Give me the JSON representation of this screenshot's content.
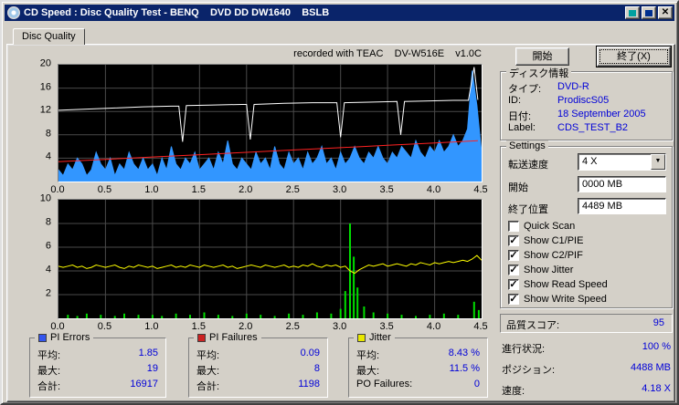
{
  "window": {
    "title": "CD Speed : Disc Quality Test - BENQ    DVD DD DW1640    BSLB",
    "close_glyph": "✕"
  },
  "icons": {
    "dropdown": "▼",
    "check": "✓"
  },
  "tab": {
    "label": "Disc Quality"
  },
  "recorded_with": "recorded with TEAC    DV-W516E    v1.0C",
  "actions": {
    "start_label": "開始",
    "exit_label": "終了(X)"
  },
  "chart_data": [
    {
      "type": "area",
      "title": "PI Errors with read/write speed overlay",
      "xlim": [
        0,
        4.5
      ],
      "ylim": [
        0,
        20
      ],
      "xgrid": 0.5,
      "ygrid": 4,
      "grid_color": "#4a4a4a",
      "xticks": [
        "0.0",
        "0.5",
        "1.0",
        "1.5",
        "2.0",
        "2.5",
        "3.0",
        "3.5",
        "4.0",
        "4.5"
      ],
      "yticks": [
        "20",
        "16",
        "12",
        "8",
        "4"
      ],
      "series": [
        {
          "name": "PI Errors",
          "render": "area",
          "color": "#3296ff",
          "x_step": 0.05,
          "values": [
            2,
            1,
            3,
            2,
            4,
            3,
            1,
            2,
            5,
            3,
            2,
            4,
            1,
            3,
            2,
            5,
            3,
            2,
            4,
            2,
            3,
            1,
            4,
            2,
            6,
            3,
            2,
            4,
            3,
            5,
            2,
            3,
            4,
            2,
            5,
            3,
            7,
            3,
            2,
            4,
            3,
            2,
            5,
            3,
            4,
            2,
            6,
            3,
            2,
            5,
            3,
            4,
            2,
            5,
            3,
            4,
            6,
            3,
            4,
            2,
            5,
            3,
            4,
            6,
            4,
            3,
            5,
            4,
            6,
            4,
            3,
            5,
            4,
            6,
            5,
            4,
            7,
            5,
            4,
            6,
            5,
            7,
            5,
            6,
            8,
            6,
            7,
            9,
            19,
            13,
            5
          ]
        },
        {
          "name": "Read Speed",
          "render": "line",
          "color": "#ff2222",
          "points": [
            [
              0,
              3.4
            ],
            [
              0.5,
              3.8
            ],
            [
              1.0,
              4.2
            ],
            [
              1.5,
              4.6
            ],
            [
              2.0,
              5.0
            ],
            [
              2.5,
              5.4
            ],
            [
              3.0,
              5.8
            ],
            [
              3.5,
              6.2
            ],
            [
              4.0,
              6.6
            ],
            [
              4.46,
              7.0
            ]
          ]
        },
        {
          "name": "Write Speed",
          "render": "line",
          "color": "#ffffff",
          "points": [
            [
              0,
              12.2
            ],
            [
              0.3,
              12.4
            ],
            [
              0.6,
              12.6
            ],
            [
              0.9,
              12.8
            ],
            [
              1.2,
              12.9
            ],
            [
              1.28,
              12.9
            ],
            [
              1.32,
              6.8
            ],
            [
              1.36,
              13.0
            ],
            [
              1.6,
              13.1
            ],
            [
              1.95,
              13.2
            ],
            [
              2.0,
              13.2
            ],
            [
              2.04,
              7.2
            ],
            [
              2.08,
              13.2
            ],
            [
              2.4,
              13.4
            ],
            [
              2.7,
              13.5
            ],
            [
              2.96,
              13.5
            ],
            [
              3.0,
              7.6
            ],
            [
              3.04,
              13.5
            ],
            [
              3.3,
              13.6
            ],
            [
              3.6,
              13.7
            ],
            [
              3.64,
              8.0
            ],
            [
              3.68,
              13.7
            ],
            [
              3.9,
              13.8
            ],
            [
              4.2,
              13.9
            ],
            [
              4.36,
              13.9
            ],
            [
              4.42,
              19.6
            ],
            [
              4.46,
              14.0
            ]
          ]
        }
      ]
    },
    {
      "type": "line",
      "title": "Jitter with PI Failures spikes",
      "xlim": [
        0,
        4.5
      ],
      "ylim": [
        0,
        10
      ],
      "xgrid": 0.5,
      "ygrid": 2,
      "grid_color": "#4a4a4a",
      "xticks": [
        "0.0",
        "0.5",
        "1.0",
        "1.5",
        "2.0",
        "2.5",
        "3.0",
        "3.5",
        "4.0",
        "4.5"
      ],
      "yticks": [
        "10",
        "8",
        "6",
        "4",
        "2"
      ],
      "series": [
        {
          "name": "PI Failures",
          "render": "bars",
          "color": "#00dd00",
          "points": [
            [
              0.1,
              0.3
            ],
            [
              0.2,
              0.2
            ],
            [
              0.3,
              0.4
            ],
            [
              0.45,
              0.3
            ],
            [
              0.6,
              0.2
            ],
            [
              0.7,
              0.4
            ],
            [
              0.85,
              0.3
            ],
            [
              1.0,
              0.3
            ],
            [
              1.1,
              0.2
            ],
            [
              1.25,
              0.4
            ],
            [
              1.4,
              0.3
            ],
            [
              1.55,
              0.5
            ],
            [
              1.7,
              0.3
            ],
            [
              1.85,
              0.2
            ],
            [
              2.0,
              0.4
            ],
            [
              2.15,
              0.3
            ],
            [
              2.3,
              0.2
            ],
            [
              2.45,
              0.4
            ],
            [
              2.6,
              0.3
            ],
            [
              2.75,
              0.5
            ],
            [
              2.9,
              0.4
            ],
            [
              3.0,
              0.8
            ],
            [
              3.05,
              2.3
            ],
            [
              3.1,
              8.0
            ],
            [
              3.14,
              5.2
            ],
            [
              3.18,
              2.6
            ],
            [
              3.25,
              1.0
            ],
            [
              3.35,
              0.5
            ],
            [
              3.5,
              0.4
            ],
            [
              3.65,
              0.3
            ],
            [
              3.8,
              0.2
            ],
            [
              3.95,
              0.3
            ],
            [
              4.1,
              0.4
            ],
            [
              4.25,
              0.3
            ],
            [
              4.42,
              1.4
            ],
            [
              4.47,
              0.7
            ]
          ]
        },
        {
          "name": "Jitter",
          "render": "line",
          "color": "#ffff00",
          "x_step": 0.05,
          "values": [
            4.4,
            4.3,
            4.4,
            4.5,
            4.3,
            4.4,
            4.2,
            4.3,
            4.5,
            4.4,
            4.3,
            4.4,
            4.5,
            4.3,
            4.2,
            4.4,
            4.3,
            4.5,
            4.4,
            4.3,
            4.4,
            4.2,
            4.3,
            4.4,
            4.5,
            4.3,
            4.4,
            4.3,
            4.5,
            4.4,
            4.3,
            4.5,
            4.4,
            4.3,
            4.4,
            4.5,
            4.3,
            4.4,
            4.2,
            4.3,
            4.4,
            4.5,
            4.4,
            4.3,
            4.5,
            4.4,
            4.3,
            4.4,
            4.5,
            4.3,
            4.4,
            4.3,
            4.5,
            4.4,
            4.6,
            4.4,
            4.3,
            4.5,
            4.4,
            4.5,
            4.3,
            4.4,
            4.0,
            3.8,
            4.1,
            4.3,
            4.5,
            4.4,
            4.5,
            4.6,
            4.4,
            4.5,
            4.6,
            4.5,
            4.4,
            4.6,
            4.5,
            4.7,
            4.6,
            4.5,
            4.7,
            4.6,
            4.7,
            4.8,
            4.7,
            4.8,
            4.9,
            4.8,
            5.0,
            5.3,
            4.9
          ]
        }
      ]
    }
  ],
  "stat_boxes": [
    {
      "legend": "PI Errors",
      "color": "#3355ee",
      "rows": [
        {
          "label": "平均:",
          "value": "1.85"
        },
        {
          "label": "最大:",
          "value": "19"
        },
        {
          "label": "合計:",
          "value": "16917"
        }
      ]
    },
    {
      "legend": "PI Failures",
      "color": "#cc2222",
      "rows": [
        {
          "label": "平均:",
          "value": "0.09"
        },
        {
          "label": "最大:",
          "value": "8"
        },
        {
          "label": "合計:",
          "value": "1198"
        }
      ]
    },
    {
      "legend": "Jitter",
      "color": "#e8e800",
      "rows": [
        {
          "label": "平均:",
          "value": "8.43 %"
        },
        {
          "label": "最大:",
          "value": "11.5 %"
        },
        {
          "label": "PO Failures:",
          "value": "0"
        }
      ]
    }
  ],
  "disc_info": {
    "title": "ディスク情報",
    "rows": [
      {
        "label": "タイプ:",
        "value": "DVD-R"
      },
      {
        "label": "ID:",
        "value": "ProdiscS05"
      },
      {
        "label": "日付:",
        "value": "18 September 2005"
      },
      {
        "label": "Label:",
        "value": "CDS_TEST_B2"
      }
    ]
  },
  "settings": {
    "title": "Settings",
    "speed": {
      "label": "転送速度",
      "value": "4 X"
    },
    "start": {
      "label": "開始",
      "value": "0000 MB"
    },
    "end": {
      "label": "終了位置",
      "value": "4489 MB"
    },
    "checkboxes": [
      {
        "label": "Quick Scan",
        "checked": false,
        "glyph": ""
      },
      {
        "label": "Show C1/PIE",
        "checked": true,
        "glyph": "✓"
      },
      {
        "label": "Show C2/PIF",
        "checked": true,
        "glyph": "✓"
      },
      {
        "label": "Show Jitter",
        "checked": true,
        "glyph": "✓"
      },
      {
        "label": "Show Read Speed",
        "checked": true,
        "glyph": "✓"
      },
      {
        "label": "Show Write Speed",
        "checked": true,
        "glyph": "✓"
      }
    ]
  },
  "quality_score": {
    "label": "品質スコア:",
    "value": "95"
  },
  "status": [
    {
      "label": "進行状況:",
      "value": "100 %"
    },
    {
      "label": "ポジション:",
      "value": "4488 MB"
    },
    {
      "label": "速度:",
      "value": "4.18 X"
    }
  ]
}
